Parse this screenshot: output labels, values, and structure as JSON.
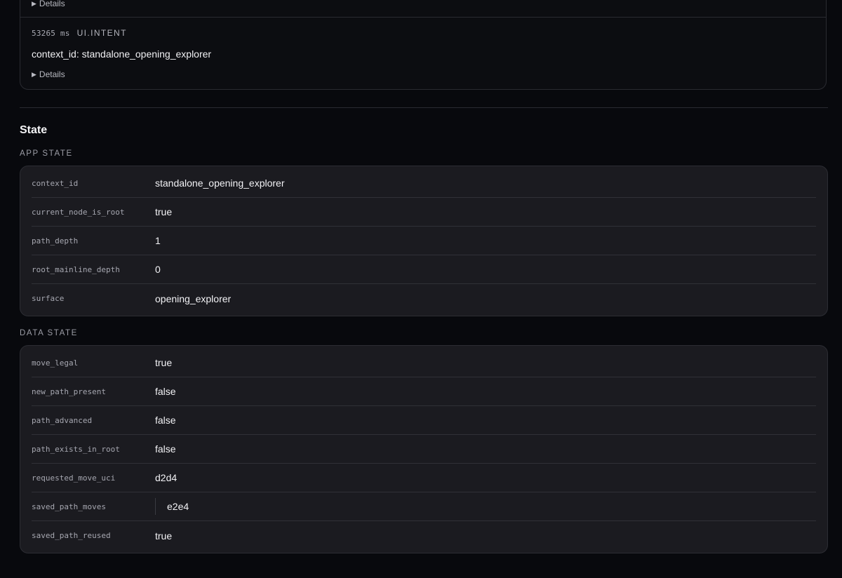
{
  "events": {
    "prev_details_label": "Details",
    "current": {
      "time": "53265 ms",
      "kind": "UI.INTENT",
      "body": "context_id: standalone_opening_explorer",
      "details_label": "Details"
    }
  },
  "state": {
    "title": "State",
    "app_state": {
      "label": "APP STATE",
      "rows": [
        {
          "key": "context_id",
          "value": "standalone_opening_explorer"
        },
        {
          "key": "current_node_is_root",
          "value": "true"
        },
        {
          "key": "path_depth",
          "value": "1"
        },
        {
          "key": "root_mainline_depth",
          "value": "0"
        },
        {
          "key": "surface",
          "value": "opening_explorer"
        }
      ]
    },
    "data_state": {
      "label": "DATA STATE",
      "rows": [
        {
          "key": "move_legal",
          "value": "true"
        },
        {
          "key": "new_path_present",
          "value": "false"
        },
        {
          "key": "path_advanced",
          "value": "false"
        },
        {
          "key": "path_exists_in_root",
          "value": "false"
        },
        {
          "key": "requested_move_uci",
          "value": "d2d4"
        },
        {
          "key": "saved_path_moves",
          "value": "e2e4"
        },
        {
          "key": "saved_path_reused",
          "value": "true"
        }
      ]
    }
  }
}
